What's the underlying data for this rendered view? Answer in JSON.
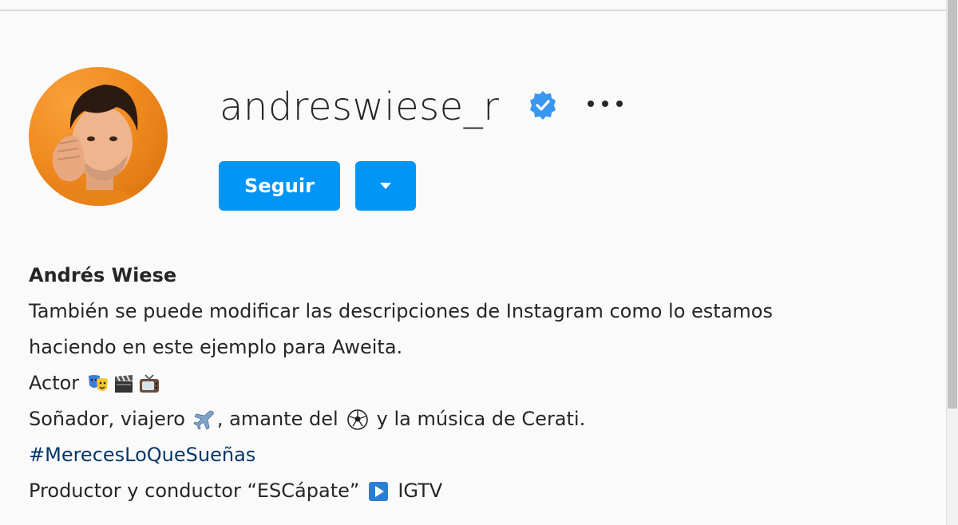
{
  "profile": {
    "username": "andreswiese_r",
    "verified": true,
    "follow_label": "Seguir",
    "display_name": "Andrés Wiese",
    "bio_line1": "También se puede modificar las descripciones de Instagram como lo estamos",
    "bio_line2": "haciendo en este ejemplo para Aweita.",
    "bio_actor": "Actor",
    "bio_dreamer_a": "Soñador, viajero",
    "bio_dreamer_b": ", amante del",
    "bio_dreamer_c": "y la música de Cerati.",
    "hashtag": "#MerecesLoQueSueñas",
    "bio_producer": "Productor y conductor “ESCápate”",
    "bio_igtv": "IGTV"
  },
  "icons": {
    "verified": "verified-badge-icon",
    "more": "more-options-icon",
    "dropdown": "chevron-down-icon",
    "emojis": [
      "performing-arts-icon",
      "clapper-board-icon",
      "television-icon",
      "airplane-icon",
      "soccer-ball-icon",
      "play-button-icon"
    ]
  },
  "colors": {
    "accent": "#0095f6",
    "hashtag": "#00376b",
    "verified": "#3897f0",
    "text": "#262626"
  }
}
